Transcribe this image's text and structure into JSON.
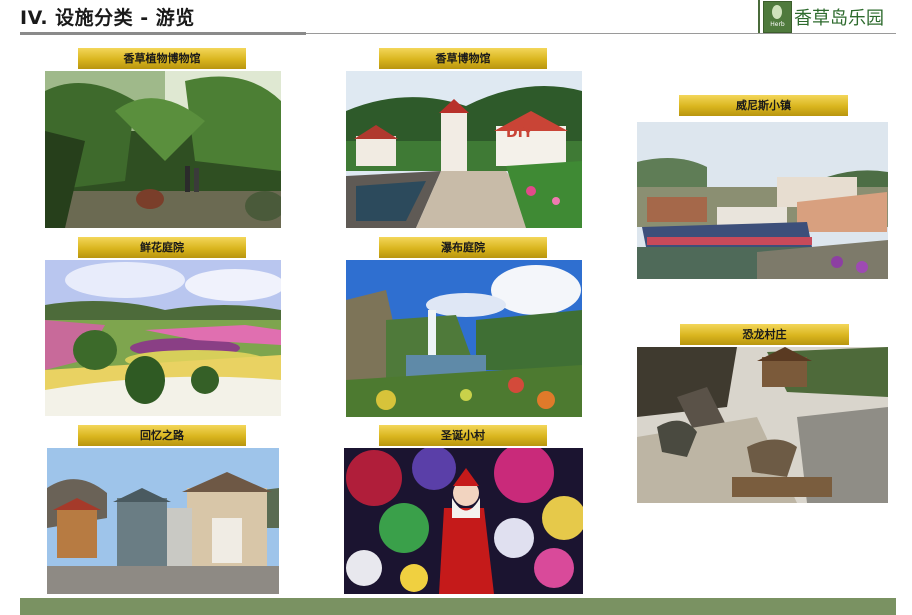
{
  "header": {
    "title": "IV. 设施分类 - 游览",
    "brand_name": "香草岛乐园",
    "logo_caption": "Herb"
  },
  "facilities": [
    {
      "name": "香草植物博物馆",
      "photo": "greenhouse"
    },
    {
      "name": "香草博物馆",
      "photo": "museum-town"
    },
    {
      "name": "威尼斯小镇",
      "photo": "venice-town"
    },
    {
      "name": "鲜花庭院",
      "photo": "flower-garden"
    },
    {
      "name": "瀑布庭院",
      "photo": "waterfall-garden"
    },
    {
      "name": "恐龙村庄",
      "photo": "dinosaur-village"
    },
    {
      "name": "回忆之路",
      "photo": "memory-road"
    },
    {
      "name": "圣诞小村",
      "photo": "christmas-village"
    }
  ],
  "colors": {
    "label_gold": "#d9b51e",
    "brand_green": "#4f7a3d",
    "footer_green": "#7a9262"
  }
}
